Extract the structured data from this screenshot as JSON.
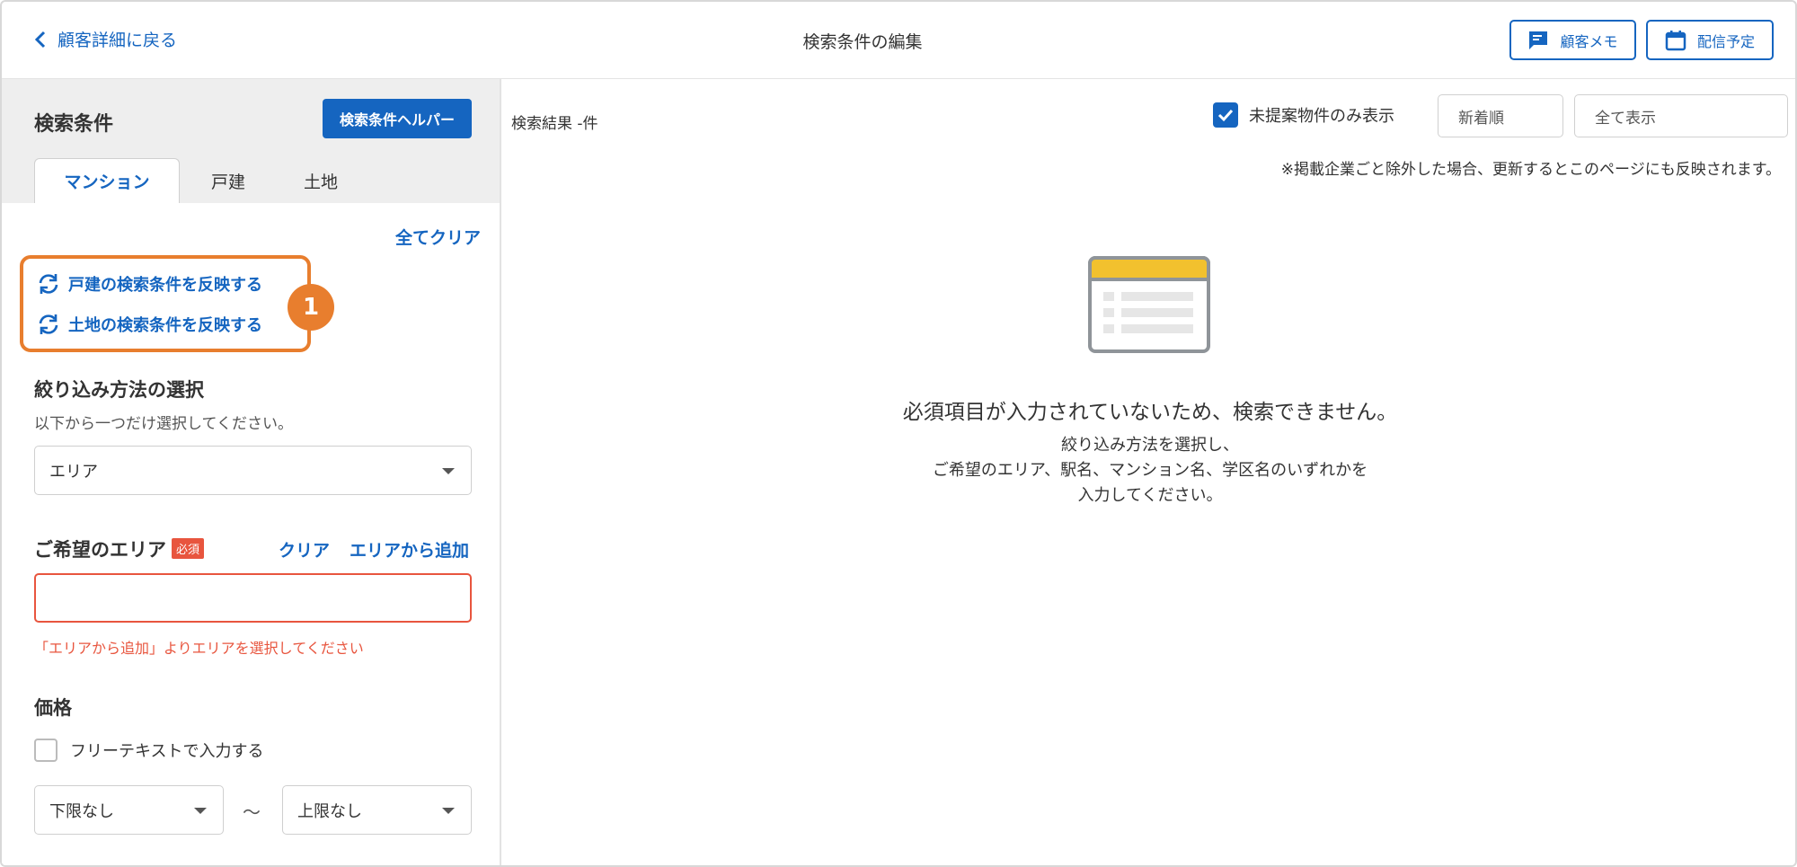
{
  "header": {
    "back_label": "顧客詳細に戻る",
    "title": "検索条件の編集",
    "memo_label": "顧客メモ",
    "schedule_label": "配信予定"
  },
  "left": {
    "title": "検索条件",
    "helper_label": "検索条件ヘルパー",
    "tabs": [
      {
        "label": "マンション",
        "active": true
      },
      {
        "label": "戸建",
        "active": false
      },
      {
        "label": "土地",
        "active": false
      }
    ],
    "clear_all": "全てクリア",
    "reflect_house": "戸建の検索条件を反映する",
    "reflect_land": "土地の検索条件を反映する",
    "callout_number": "1",
    "filter_method": {
      "title": "絞り込み方法の選択",
      "hint": "以下から一つだけ選択してください。",
      "value": "エリア"
    },
    "area": {
      "title": "ご希望のエリア",
      "required": "必須",
      "clear": "クリア",
      "add": "エリアから追加",
      "value": "",
      "error": "「エリアから追加」よりエリアを選択してください"
    },
    "price": {
      "title": "価格",
      "free_text_label": "フリーテキストで入力する",
      "free_text_checked": false,
      "min": "下限なし",
      "separator": "〜",
      "max": "上限なし"
    }
  },
  "right": {
    "result_count": "検索結果 -件",
    "unproposed_only_label": "未提案物件のみ表示",
    "unproposed_only_checked": true,
    "sort_value": "新着順",
    "display_value": "全て表示",
    "note": "※掲載企業ごと除外した場合、更新するとこのページにも反映されます。",
    "empty_title": "必須項目が入力されていないため、検索できません。",
    "empty_lines": [
      "絞り込み方法を選択し、",
      "ご希望のエリア、駅名、マンション名、学区名のいずれかを",
      "入力してください。"
    ]
  },
  "colors": {
    "accent": "#1565c0",
    "callout": "#e87e2e",
    "error": "#e8553e",
    "icon_header": "#f2c12e"
  }
}
